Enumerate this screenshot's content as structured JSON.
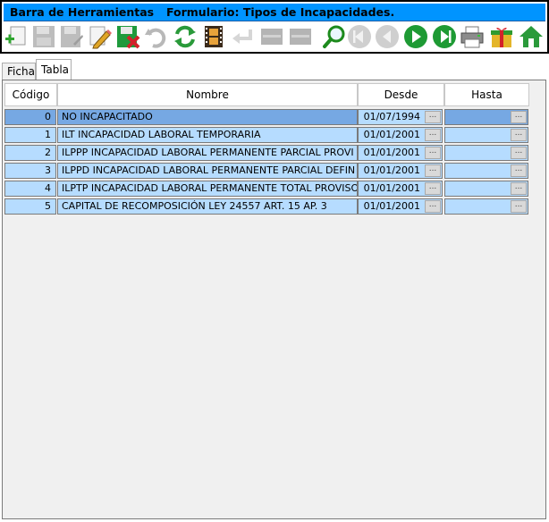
{
  "toolbar": {
    "title_left": "Barra de Herramientas",
    "title_right": "Formulario: Tipos de Incapacidades.",
    "buttons": [
      {
        "icon": "add-icon"
      },
      {
        "icon": "save-disabled-icon"
      },
      {
        "icon": "save-edit-disabled-icon"
      },
      {
        "icon": "edit-pencil-icon"
      },
      {
        "icon": "delete-icon"
      },
      {
        "icon": "undo-disabled-icon"
      },
      {
        "icon": "refresh-icon"
      },
      {
        "icon": "film-icon"
      },
      {
        "icon": "return-icon"
      },
      {
        "icon": "grid-disabled-icon"
      },
      {
        "icon": "grid-disabled-icon-2"
      },
      {
        "icon": "search-icon"
      },
      {
        "icon": "first-record-disabled-icon"
      },
      {
        "icon": "previous-record-disabled-icon"
      },
      {
        "icon": "next-record-icon"
      },
      {
        "icon": "last-record-icon"
      },
      {
        "icon": "printer-icon"
      },
      {
        "icon": "gift-icon"
      },
      {
        "icon": "home-icon"
      }
    ]
  },
  "tabs": [
    {
      "label": "Ficha",
      "active": false
    },
    {
      "label": "Tabla",
      "active": true
    }
  ],
  "table": {
    "columns": {
      "code": "Código",
      "name": "Nombre",
      "from": "Desde",
      "to": "Hasta"
    },
    "lookup_label": "...",
    "rows": [
      {
        "code": "0",
        "name": "NO INCAPACITADO",
        "from": "01/07/1994",
        "to": ""
      },
      {
        "code": "1",
        "name": "ILT INCAPACIDAD LABORAL TEMPORARIA",
        "from": "01/01/2001",
        "to": ""
      },
      {
        "code": "2",
        "name": "ILPPP INCAPACIDAD LABORAL PERMANENTE PARCIAL PROVI",
        "from": "01/01/2001",
        "to": ""
      },
      {
        "code": "3",
        "name": "ILPPD INCAPACIDAD LABORAL PERMANENTE PARCIAL DEFIN",
        "from": "01/01/2001",
        "to": ""
      },
      {
        "code": "4",
        "name": "ILPTP INCAPACIDAD LABORAL PERMANENTE TOTAL PROVISO",
        "from": "01/01/2001",
        "to": ""
      },
      {
        "code": "5",
        "name": "CAPITAL DE RECOMPOSICIÓN LEY 24557 ART. 15 AP. 3",
        "from": "01/01/2001",
        "to": ""
      }
    ]
  },
  "colors": {
    "title_bar": "#0094ff",
    "row_bg": "#b6dcff",
    "row_selected_bg": "#76a8e3"
  }
}
